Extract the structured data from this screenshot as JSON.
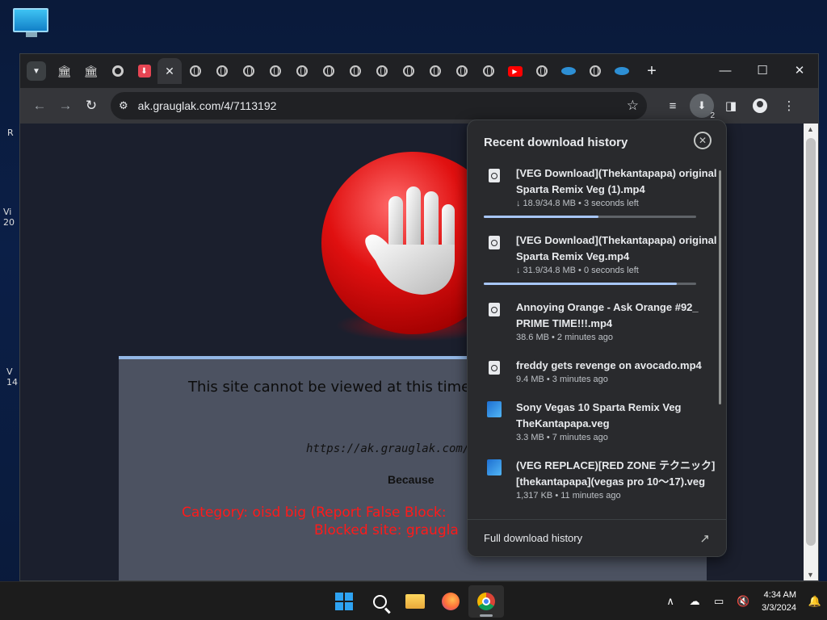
{
  "browser": {
    "window_controls": {
      "minimize": "—",
      "maximize": "☐",
      "close": "✕"
    },
    "active_tab_close": "✕",
    "new_tab": "+",
    "url": "ak.grauglak.com/4/7113192",
    "download_count": "2"
  },
  "block_page": {
    "title": "This site cannot be viewed at this time.",
    "url": "https://ak.grauglak.com/4/",
    "because": "Because",
    "category": "Category: oisd big (Report False Block:",
    "blocked_site": "Blocked site: graugla"
  },
  "downloads": {
    "title": "Recent download history",
    "items": [
      {
        "name": "[VEG Download](Thekantapapa) original Sparta Remix Veg (1).mp4",
        "meta": "↓ 18.9/34.8 MB • 3 seconds left",
        "progress": 0.54,
        "icon": "video-file-icon"
      },
      {
        "name": "[VEG Download](Thekantapapa) original Sparta Remix Veg.mp4",
        "meta": "↓ 31.9/34.8 MB • 0 seconds left",
        "progress": 0.91,
        "icon": "video-file-icon"
      },
      {
        "name": "Annoying Orange - Ask Orange #92_ PRIME TIME!!!.mp4",
        "meta": "38.6 MB • 2 minutes ago",
        "icon": "video-file-icon"
      },
      {
        "name": "freddy gets revenge on avocado.mp4",
        "meta": "9.4 MB • 3 minutes ago",
        "icon": "video-file-icon"
      },
      {
        "name": "Sony Vegas 10 Sparta Remix Veg TheKantapapa.veg",
        "meta": "3.3 MB • 7 minutes ago",
        "icon": "vegas-file-icon"
      },
      {
        "name": "(VEG REPLACE)[RED ZONE テクニック][thekantapapa](vegas pro 10～17).veg",
        "meta": "1,317 KB • 11 minutes ago",
        "icon": "vegas-file-icon"
      }
    ],
    "footer": "Full download history"
  },
  "taskbar": {
    "time": "4:34 AM",
    "date": "3/3/2024"
  }
}
